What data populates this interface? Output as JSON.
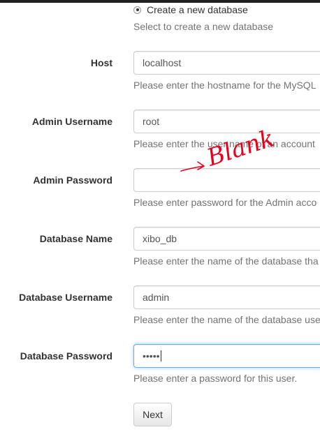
{
  "create_db": {
    "radio_label": "Create a new database",
    "help": "Select to create a new database"
  },
  "fields": {
    "host": {
      "label": "Host",
      "value": "localhost",
      "help": "Please enter the hostname for the MySQL"
    },
    "admin_username": {
      "label": "Admin Username",
      "value": "root",
      "help": "Please enter the user name of an account"
    },
    "admin_password": {
      "label": "Admin Password",
      "value": "",
      "help": "Please enter password for the Admin acco"
    },
    "database_name": {
      "label": "Database Name",
      "value": "xibo_db",
      "help": "Please enter the name of the database tha"
    },
    "database_username": {
      "label": "Database Username",
      "value": "admin",
      "help": "Please enter the name of the database use"
    },
    "database_password": {
      "label": "Database Password",
      "value": "•••••",
      "help": "Please enter a password for this user."
    }
  },
  "next_button": {
    "label": "Next"
  },
  "annotation": {
    "text": "Blank",
    "color": "#e8001c"
  }
}
